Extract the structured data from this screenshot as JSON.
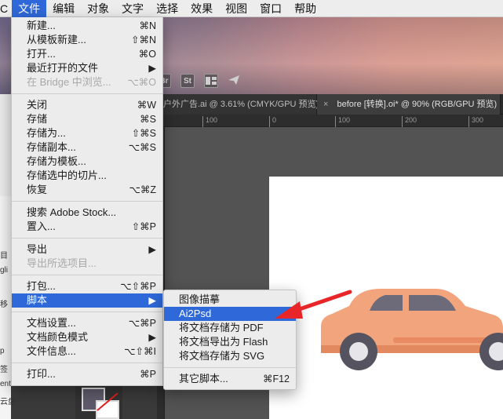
{
  "menubar": {
    "app_fragment": "C",
    "items": [
      "文件",
      "编辑",
      "对象",
      "文字",
      "选择",
      "效果",
      "视图",
      "窗口",
      "帮助"
    ],
    "active_index": 0
  },
  "toolbar": {
    "icons": [
      "Br",
      "St"
    ]
  },
  "tabs": [
    {
      "label": "户外广告.ai @ 3.61% (CMYK/GPU 预览)"
    },
    {
      "close": "×",
      "label": "before [转换].oi* @ 90% (RGB/GPU 预览)"
    }
  ],
  "ruler": {
    "ticks": [
      "100",
      "0",
      "100",
      "200",
      "300"
    ]
  },
  "left_panel": {
    "labels": [
      "目",
      "gli",
      "移",
      "p",
      "签",
      "ent",
      "云盘"
    ]
  },
  "file_menu": {
    "groups": [
      [
        {
          "label": "新建...",
          "shortcut": "⌘N"
        },
        {
          "label": "从模板新建...",
          "shortcut": "⇧⌘N"
        },
        {
          "label": "打开...",
          "shortcut": "⌘O"
        },
        {
          "label": "最近打开的文件",
          "shortcut": "▶"
        },
        {
          "label": "在 Bridge 中浏览...",
          "shortcut": "⌥⌘O",
          "disabled": true
        }
      ],
      [
        {
          "label": "关闭",
          "shortcut": "⌘W"
        },
        {
          "label": "存储",
          "shortcut": "⌘S"
        },
        {
          "label": "存储为...",
          "shortcut": "⇧⌘S"
        },
        {
          "label": "存储副本...",
          "shortcut": "⌥⌘S"
        },
        {
          "label": "存储为模板...",
          "shortcut": ""
        },
        {
          "label": "存储选中的切片...",
          "shortcut": ""
        },
        {
          "label": "恢复",
          "shortcut": "⌥⌘Z"
        }
      ],
      [
        {
          "label": "搜索 Adobe Stock...",
          "shortcut": ""
        },
        {
          "label": "置入...",
          "shortcut": "⇧⌘P"
        }
      ],
      [
        {
          "label": "导出",
          "shortcut": "▶"
        },
        {
          "label": "导出所选项目...",
          "shortcut": "",
          "disabled": true
        }
      ],
      [
        {
          "label": "打包...",
          "shortcut": "⌥⇧⌘P"
        },
        {
          "label": "脚本",
          "shortcut": "▶",
          "highlight": true
        }
      ],
      [
        {
          "label": "文档设置...",
          "shortcut": "⌥⌘P"
        },
        {
          "label": "文档颜色模式",
          "shortcut": "▶"
        },
        {
          "label": "文件信息...",
          "shortcut": "⌥⇧⌘I"
        }
      ],
      [
        {
          "label": "打印...",
          "shortcut": "⌘P"
        }
      ]
    ]
  },
  "script_submenu": {
    "items": [
      {
        "label": "图像描摹",
        "shortcut": ""
      },
      {
        "label": "Ai2Psd",
        "shortcut": "",
        "highlight": true
      },
      {
        "label": "将文档存储为 PDF",
        "shortcut": ""
      },
      {
        "label": "将文档导出为 Flash",
        "shortcut": ""
      },
      {
        "label": "将文档存储为 SVG",
        "shortcut": ""
      }
    ],
    "other": {
      "label": "其它脚本...",
      "shortcut": "⌘F12"
    }
  },
  "colors": {
    "highlight": "#2f68d8",
    "annotation_arrow": "#e8262a",
    "car_body": "#f2a57d",
    "car_window": "#6d6a7a"
  }
}
